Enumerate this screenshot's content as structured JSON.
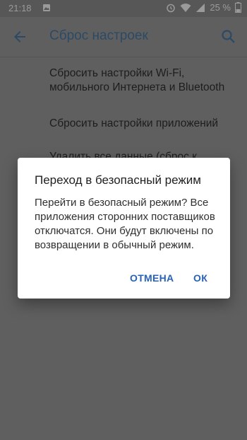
{
  "status_bar": {
    "time": "21:18",
    "battery_percent": "25 %",
    "icons": [
      "image-notification-icon",
      "alarm-icon",
      "wifi-icon",
      "signal-icon",
      "battery-icon"
    ]
  },
  "toolbar": {
    "title": "Сброс настроек",
    "back_icon": "arrow-back-icon",
    "search_icon": "search-icon",
    "title_color": "#2c4a66"
  },
  "list": {
    "items": [
      {
        "label": "Сбросить настройки Wi-Fi, мобильного Интернета и Bluetooth"
      },
      {
        "label": "Сбросить настройки приложений"
      },
      {
        "label": "Удалить все данные (сброс к заводским настройкам)"
      }
    ]
  },
  "dialog": {
    "title": "Переход в безопасный режим",
    "message": "Перейти в безопасный режим? Все приложения сторонних поставщиков отключатся. Они будут включены по возвращении в обычный режим.",
    "cancel_label": "ОТМЕНА",
    "ok_label": "ОК",
    "accent_color": "#2962b5"
  }
}
